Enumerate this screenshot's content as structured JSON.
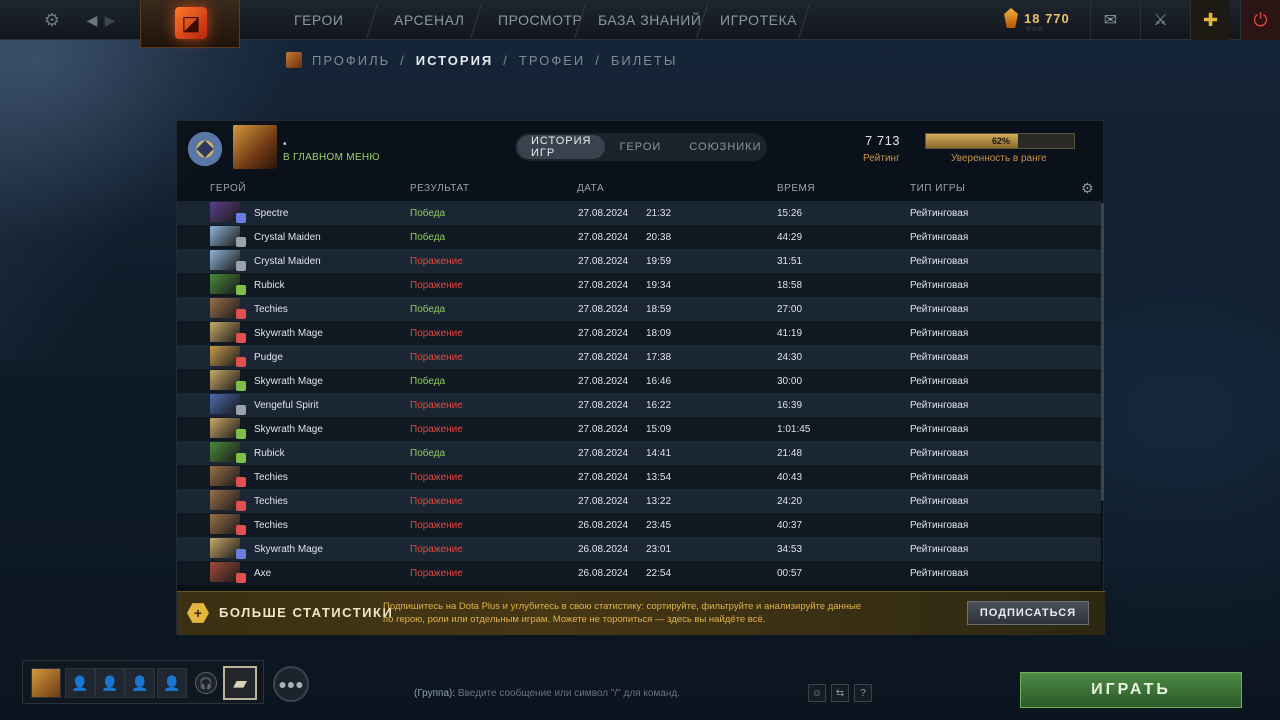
{
  "topbar": {
    "nav": [
      "ГЕРОИ",
      "АРСЕНАЛ",
      "ПРОСМОТР",
      "БАЗА ЗНАНИЙ",
      "ИГРОТЕКА"
    ],
    "shards": "18 770"
  },
  "subnav": [
    "ПРОФИЛЬ",
    "ИСТОРИЯ",
    "ТРОФЕИ",
    "БИЛЕТЫ"
  ],
  "profile": {
    "name": "•",
    "status": "В ГЛАВНОМ МЕНЮ",
    "tabs": [
      "ИСТОРИЯ ИГР",
      "ГЕРОИ",
      "СОЮЗНИКИ"
    ],
    "rating_value": "7 713",
    "rating_label": "Рейтинг",
    "confidence_value": "62%",
    "confidence_fraction": 0.62,
    "confidence_label": "Уверенность в ранге"
  },
  "columns": [
    "ГЕРОЙ",
    "РЕЗУЛЬТАТ",
    "ДАТА",
    "ВРЕМЯ",
    "ТИП ИГРЫ"
  ],
  "matches": [
    {
      "hero": "Spectre",
      "result": "Победа",
      "win": true,
      "date": "27.08.2024",
      "time": "21:32",
      "duration": "15:26",
      "type": "Рейтинговая",
      "color": "#5b3f8a",
      "role": "#6a7ee0"
    },
    {
      "hero": "Crystal Maiden",
      "result": "Победа",
      "win": true,
      "date": "27.08.2024",
      "time": "20:38",
      "duration": "44:29",
      "type": "Рейтинговая",
      "color": "#8fb4d8",
      "role": "#9aa3ad"
    },
    {
      "hero": "Crystal Maiden",
      "result": "Поражение",
      "win": false,
      "date": "27.08.2024",
      "time": "19:59",
      "duration": "31:51",
      "type": "Рейтинговая",
      "color": "#8fb4d8",
      "role": "#9aa3ad"
    },
    {
      "hero": "Rubick",
      "result": "Поражение",
      "win": false,
      "date": "27.08.2024",
      "time": "19:34",
      "duration": "18:58",
      "type": "Рейтинговая",
      "color": "#4a8a3a",
      "role": "#7cc04a"
    },
    {
      "hero": "Techies",
      "result": "Победа",
      "win": true,
      "date": "27.08.2024",
      "time": "18:59",
      "duration": "27:00",
      "type": "Рейтинговая",
      "color": "#9a7048",
      "role": "#e05050"
    },
    {
      "hero": "Skywrath Mage",
      "result": "Поражение",
      "win": false,
      "date": "27.08.2024",
      "time": "18:09",
      "duration": "41:19",
      "type": "Рейтинговая",
      "color": "#c8a868",
      "role": "#e05050"
    },
    {
      "hero": "Pudge",
      "result": "Поражение",
      "win": false,
      "date": "27.08.2024",
      "time": "17:38",
      "duration": "24:30",
      "type": "Рейтинговая",
      "color": "#c89a4a",
      "role": "#e05050"
    },
    {
      "hero": "Skywrath Mage",
      "result": "Победа",
      "win": true,
      "date": "27.08.2024",
      "time": "16:46",
      "duration": "30:00",
      "type": "Рейтинговая",
      "color": "#c8a868",
      "role": "#7cc04a"
    },
    {
      "hero": "Vengeful Spirit",
      "result": "Поражение",
      "win": false,
      "date": "27.08.2024",
      "time": "16:22",
      "duration": "16:39",
      "type": "Рейтинговая",
      "color": "#4a6ab0",
      "role": "#9aa3ad"
    },
    {
      "hero": "Skywrath Mage",
      "result": "Поражение",
      "win": false,
      "date": "27.08.2024",
      "time": "15:09",
      "duration": "1:01:45",
      "type": "Рейтинговая",
      "color": "#c8a868",
      "role": "#7cc04a"
    },
    {
      "hero": "Rubick",
      "result": "Победа",
      "win": true,
      "date": "27.08.2024",
      "time": "14:41",
      "duration": "21:48",
      "type": "Рейтинговая",
      "color": "#4a8a3a",
      "role": "#7cc04a"
    },
    {
      "hero": "Techies",
      "result": "Поражение",
      "win": false,
      "date": "27.08.2024",
      "time": "13:54",
      "duration": "40:43",
      "type": "Рейтинговая",
      "color": "#9a7048",
      "role": "#e05050"
    },
    {
      "hero": "Techies",
      "result": "Поражение",
      "win": false,
      "date": "27.08.2024",
      "time": "13:22",
      "duration": "24:20",
      "type": "Рейтинговая",
      "color": "#9a7048",
      "role": "#e05050"
    },
    {
      "hero": "Techies",
      "result": "Поражение",
      "win": false,
      "date": "26.08.2024",
      "time": "23:45",
      "duration": "40:37",
      "type": "Рейтинговая",
      "color": "#9a7048",
      "role": "#e05050"
    },
    {
      "hero": "Skywrath Mage",
      "result": "Поражение",
      "win": false,
      "date": "26.08.2024",
      "time": "23:01",
      "duration": "34:53",
      "type": "Рейтинговая",
      "color": "#c8a868",
      "role": "#6a7ee0"
    },
    {
      "hero": "Axe",
      "result": "Поражение",
      "win": false,
      "date": "26.08.2024",
      "time": "22:54",
      "duration": "00:57",
      "type": "Рейтинговая",
      "color": "#a04a3a",
      "role": "#e05050"
    }
  ],
  "promo": {
    "title": "БОЛЬШЕ СТАТИСТИКИ",
    "text": "Подпишитесь на Dota Plus и углубитесь в свою статистику: сортируйте, фильтруйте и анализируйте данные по герою, роли или отдельным играм. Можете не торопиться — здесь вы найдёте всё.",
    "button": "ПОДПИСАТЬСЯ"
  },
  "chat": {
    "channel": "(Группа):",
    "placeholder": "Введите сообщение или символ \"/\" для команд."
  },
  "play_button": "ИГРАТЬ",
  "icons": [
    "gear-icon",
    "back-arrow-icon",
    "forward-arrow-icon",
    "dota-logo-icon",
    "shard-icon",
    "mail-icon",
    "armory-icon",
    "dota-plus-icon",
    "power-icon",
    "rank-medal-icon",
    "settings-gear-icon",
    "voice-icon",
    "guild-icon",
    "party-icon",
    "emoji-icon",
    "help-icon"
  ]
}
